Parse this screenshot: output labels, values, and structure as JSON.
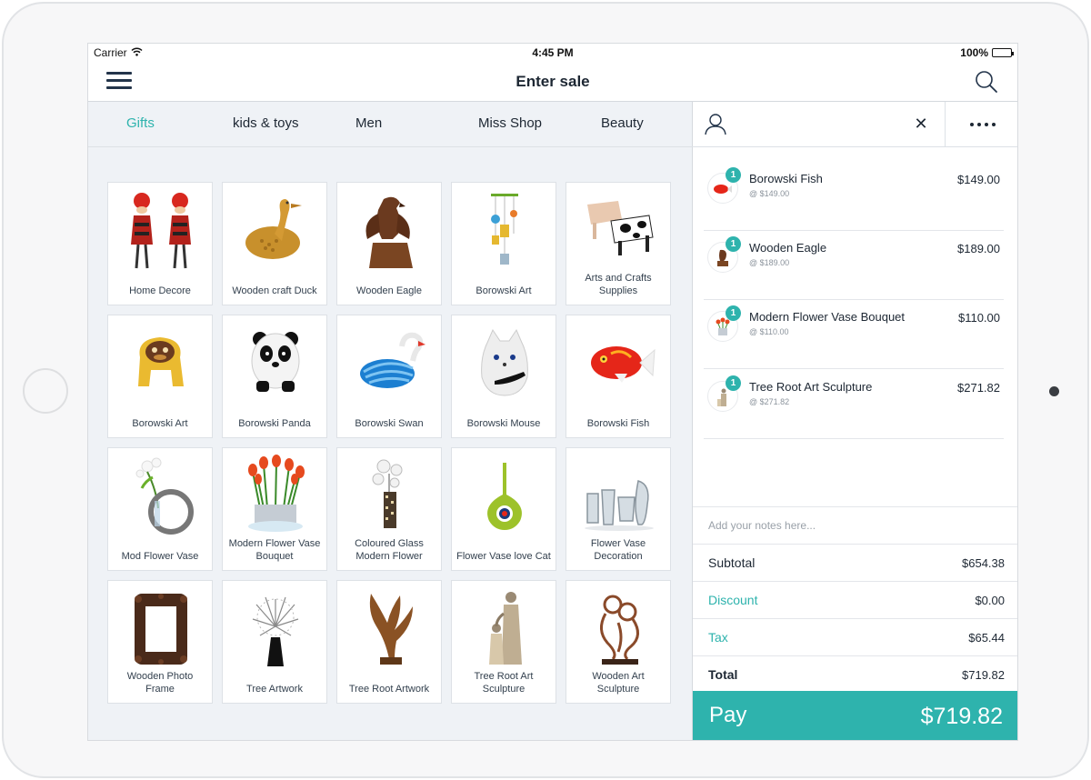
{
  "status_bar": {
    "carrier": "Carrier",
    "time": "4:45 PM",
    "battery": "100%"
  },
  "nav": {
    "title": "Enter sale"
  },
  "tabs": [
    {
      "label": "Gifts",
      "active": true
    },
    {
      "label": "kids & toys",
      "active": false
    },
    {
      "label": "Men",
      "active": false
    },
    {
      "label": "Miss Shop",
      "active": false
    },
    {
      "label": "Beauty",
      "active": false
    }
  ],
  "products": [
    {
      "label": "Home Decore",
      "icon": "twin-figures-icon"
    },
    {
      "label": "Wooden craft Duck",
      "icon": "duck-icon"
    },
    {
      "label": "Wooden Eagle",
      "icon": "eagle-icon"
    },
    {
      "label": "Borowski Art",
      "icon": "mobile-icon"
    },
    {
      "label": "Arts and Crafts Supplies",
      "icon": "cow-icon"
    },
    {
      "label": "Borowski Art",
      "icon": "monkey-icon"
    },
    {
      "label": "Borowski Panda",
      "icon": "panda-icon"
    },
    {
      "label": "Borowski Swan",
      "icon": "swan-icon"
    },
    {
      "label": "Borowski Mouse",
      "icon": "mouse-icon"
    },
    {
      "label": "Borowski Fish",
      "icon": "fish-icon"
    },
    {
      "label": "Mod Flower Vase",
      "icon": "ring-vase-icon"
    },
    {
      "label": "Modern Flower Vase Bouquet",
      "icon": "tulips-icon"
    },
    {
      "label": "Coloured Glass Modern Flower",
      "icon": "glass-flower-icon"
    },
    {
      "label": "Flower Vase love Cat",
      "icon": "green-vase-icon"
    },
    {
      "label": "Flower Vase Decoration",
      "icon": "glass-vases-icon"
    },
    {
      "label": "Wooden Photo Frame",
      "icon": "photo-frame-icon"
    },
    {
      "label": "Tree Artwork",
      "icon": "tree-icon"
    },
    {
      "label": "Tree Root Artwork",
      "icon": "root-icon"
    },
    {
      "label": "Tree Root Art Sculpture",
      "icon": "family-sculpture-icon"
    },
    {
      "label": "Wooden Art Sculpture",
      "icon": "bronze-sculpture-icon"
    }
  ],
  "cart": {
    "items": [
      {
        "qty": "1",
        "name": "Borowski Fish",
        "unit": "@ $149.00",
        "price": "$149.00",
        "icon": "fish-icon"
      },
      {
        "qty": "1",
        "name": "Wooden Eagle",
        "unit": "@ $189.00",
        "price": "$189.00",
        "icon": "eagle-icon"
      },
      {
        "qty": "1",
        "name": "Modern Flower Vase Bouquet",
        "unit": "@ $110.00",
        "price": "$110.00",
        "icon": "tulips-icon"
      },
      {
        "qty": "1",
        "name": "Tree Root Art Sculpture",
        "unit": "@ $271.82",
        "price": "$271.82",
        "icon": "family-sculpture-icon"
      }
    ],
    "notes_placeholder": "Add your notes here...",
    "subtotal": {
      "label": "Subtotal",
      "value": "$654.38"
    },
    "discount": {
      "label": "Discount",
      "value": "$0.00"
    },
    "tax": {
      "label": "Tax",
      "value": "$65.44"
    },
    "total": {
      "label": "Total",
      "value": "$719.82"
    },
    "pay": {
      "label": "Pay",
      "amount": "$719.82"
    }
  },
  "colors": {
    "accent": "#2eb3ad",
    "text": "#1d2733",
    "panel_bg": "#eff2f6"
  }
}
